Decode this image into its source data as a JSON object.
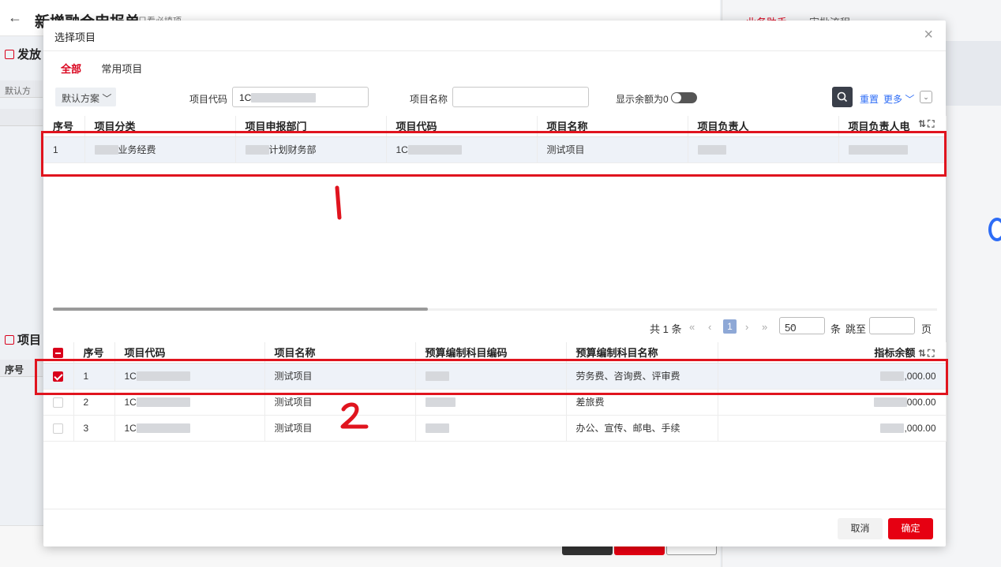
{
  "background": {
    "page_title": "新增融合申报单",
    "only_required_label": "只看必填项",
    "section_issue": "发放",
    "section_project": "项目",
    "scheme_short": "默认方",
    "seq_short": "序号",
    "right_tab_assistant": "业务助手",
    "right_tab_flow": "审批流程"
  },
  "modal": {
    "title": "选择项目",
    "close": "×",
    "tabs": [
      {
        "label": "全部",
        "active": true
      },
      {
        "label": "常用项目",
        "active": false
      }
    ],
    "filter": {
      "scheme": "默认方案",
      "code_label": "项目代码",
      "code_value": "1C",
      "name_label": "项目名称",
      "name_value": "",
      "zero_balance_label": "显示余额为0",
      "reset": "重置",
      "more": "更多"
    },
    "project_table": {
      "columns": [
        "序号",
        "项目分类",
        "项目申报部门",
        "项目代码",
        "项目名称",
        "项目负责人",
        "项目负责人电"
      ],
      "rows": [
        {
          "seq": "1",
          "category": "业务经费",
          "dept": "计划财务部",
          "code": "1C",
          "name": "测试项目"
        }
      ]
    },
    "pager": {
      "total": "共 1 条",
      "current_page": "1",
      "page_size": "50",
      "unit": "条",
      "jump_to": "跳至",
      "page": "页"
    },
    "budget_table": {
      "columns": [
        "序号",
        "项目代码",
        "项目名称",
        "预算编制科目编码",
        "预算编制科目名称",
        "指标余额"
      ],
      "rows": [
        {
          "seq": "1",
          "code": "1C",
          "name": "测试项目",
          "subject": "劳务费、咨询费、评审费",
          "amount": ",000.00",
          "checked": true
        },
        {
          "seq": "2",
          "code": "1C",
          "name": "测试项目",
          "subject": "差旅费",
          "amount": "000.00",
          "checked": false
        },
        {
          "seq": "3",
          "code": "1C",
          "name": "测试项目",
          "subject": "办公、宣传、邮电、手续",
          "amount": ",000.00",
          "checked": false
        }
      ]
    },
    "buttons": {
      "cancel": "取消",
      "ok": "确定"
    }
  },
  "annotations": {
    "box1_label": "1",
    "box2_label": "2",
    "color": "#e0141e"
  }
}
